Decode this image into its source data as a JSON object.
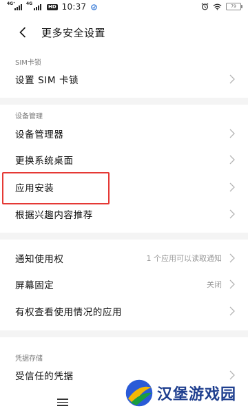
{
  "status_bar": {
    "sim1_tag": "4G⁺",
    "sim2_tag": "4G",
    "hd_badge": "HD",
    "time": "10:37",
    "battery": "79"
  },
  "header": {
    "title": "更多安全设置"
  },
  "sections": {
    "sim": {
      "label": "SIM卡锁",
      "set_sim_lock": "设置 SIM 卡锁"
    },
    "device": {
      "label": "设备管理",
      "device_admin": "设备管理器",
      "change_launcher": "更换系统桌面",
      "app_install": "应用安装",
      "recommendations": "根据兴趣内容推荐"
    },
    "access": {
      "notification_access": "通知使用权",
      "notification_access_value": "1 个应用可以读取通知",
      "screen_pinning": "屏幕固定",
      "screen_pinning_value": "关闭",
      "usage_access": "有权查看使用情况的应用"
    },
    "credentials": {
      "label": "凭据存储",
      "trusted_credentials": "受信任的凭据"
    }
  },
  "watermark": {
    "text": "汉堡游戏园"
  },
  "colors": {
    "highlight": "#e53935",
    "watermark_blue": "#1f3f8f"
  }
}
